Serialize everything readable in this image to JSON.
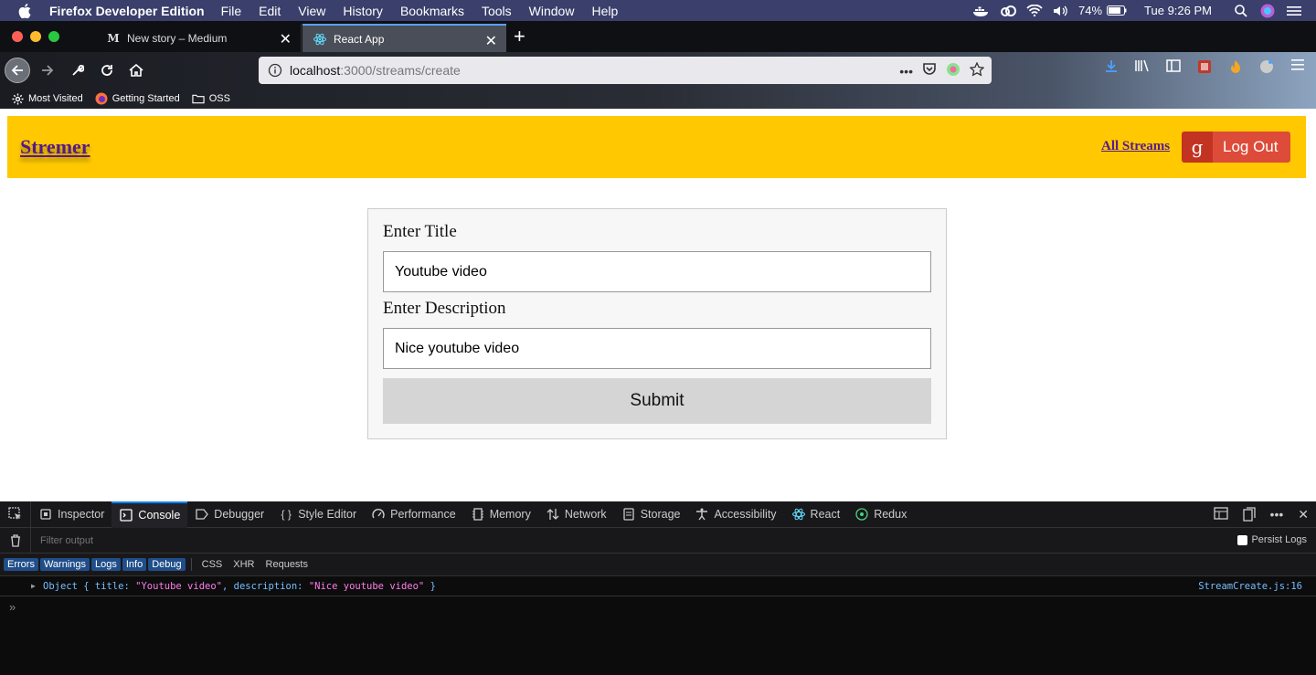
{
  "menubar": {
    "app_name": "Firefox Developer Edition",
    "menus": [
      "File",
      "Edit",
      "View",
      "History",
      "Bookmarks",
      "Tools",
      "Window",
      "Help"
    ],
    "battery": "74%",
    "clock": "Tue 9:26 PM"
  },
  "browser": {
    "tabs": [
      {
        "title": "New story – Medium",
        "icon": "medium-icon"
      },
      {
        "title": "React App",
        "icon": "react-icon"
      }
    ],
    "url_host": "localhost",
    "url_path": ":3000/streams/create",
    "bookmarks": [
      "Most Visited",
      "Getting Started",
      "OSS"
    ]
  },
  "app": {
    "brand": "Stremer",
    "all_streams": "All Streams",
    "logout": "Log Out",
    "google_glyph": "g"
  },
  "form": {
    "title_label": "Enter Title",
    "title_value": "Youtube video",
    "description_label": "Enter Description",
    "description_value": "Nice youtube video",
    "submit": "Submit"
  },
  "devtools": {
    "tabs": [
      "Inspector",
      "Console",
      "Debugger",
      "Style Editor",
      "Performance",
      "Memory",
      "Network",
      "Storage",
      "Accessibility",
      "React",
      "Redux"
    ],
    "selected_tab": "Console",
    "filter_placeholder": "Filter output",
    "persist_logs": "Persist Logs",
    "levels": [
      "Errors",
      "Warnings",
      "Logs",
      "Info",
      "Debug"
    ],
    "extra_filters": [
      "CSS",
      "XHR",
      "Requests"
    ],
    "log": {
      "prefix": "Object { title: ",
      "title_str": "\"Youtube video\"",
      "mid": ", description: ",
      "desc_str": "\"Nice youtube video\"",
      "suffix": " }",
      "source": "StreamCreate.js:16"
    },
    "prompt": "»"
  }
}
